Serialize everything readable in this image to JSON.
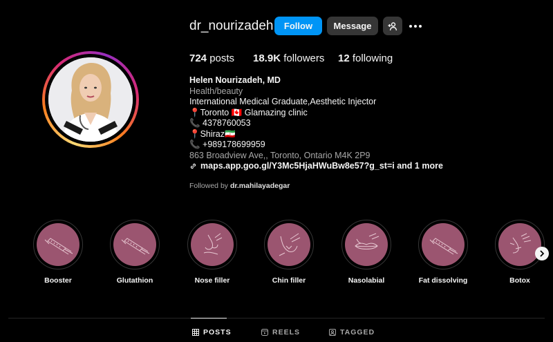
{
  "profile": {
    "username": "dr_nourizadeh",
    "follow_label": "Follow",
    "message_label": "Message",
    "avatar_icon": "add-person-icon"
  },
  "stats": {
    "posts_count": "724",
    "posts_label": "posts",
    "followers_count": "18.9K",
    "followers_label": "followers",
    "following_count": "12",
    "following_label": "following"
  },
  "bio": {
    "name": "Helen Nourizadeh, MD",
    "category": "Health/beauty",
    "lines": [
      "International Medical Graduate,Aesthetic Injector",
      "📍Toronto 🇨🇦 Glamazing clinic",
      "📞 4378760053",
      "📍Shiraz🇮🇷",
      "📞 +989178699959"
    ],
    "address": "863 Broadview Ave,, Toronto, Ontario M4K 2P9",
    "link": "maps.app.goo.gl/Y3Mc5HjaHWuBw8e57?g_st=i and 1 more",
    "followed_prefix": "Followed by",
    "followed_by": "dr.mahilayadegar"
  },
  "highlights": [
    {
      "label": "Booster",
      "icon": "syringe-icon"
    },
    {
      "label": "Glutathion",
      "icon": "syringe-icon"
    },
    {
      "label": "Nose filler",
      "icon": "nose-sketch-icon"
    },
    {
      "label": "Chin filler",
      "icon": "chin-sketch-icon"
    },
    {
      "label": "Nasolabial",
      "icon": "lips-sketch-icon"
    },
    {
      "label": "Fat dissolving",
      "icon": "syringe-icon"
    },
    {
      "label": "Botox",
      "icon": "face-sketch-icon"
    }
  ],
  "tabs": [
    {
      "label": "POSTS",
      "icon": "grid-icon",
      "active": true
    },
    {
      "label": "REELS",
      "icon": "reels-icon",
      "active": false
    },
    {
      "label": "TAGGED",
      "icon": "tagged-icon",
      "active": false
    }
  ],
  "colors": {
    "background": "#000000",
    "follow_button": "#0095f6",
    "secondary_button": "#363636",
    "highlight_fill": "#9b5570",
    "muted_text": "#a8a8a8"
  }
}
